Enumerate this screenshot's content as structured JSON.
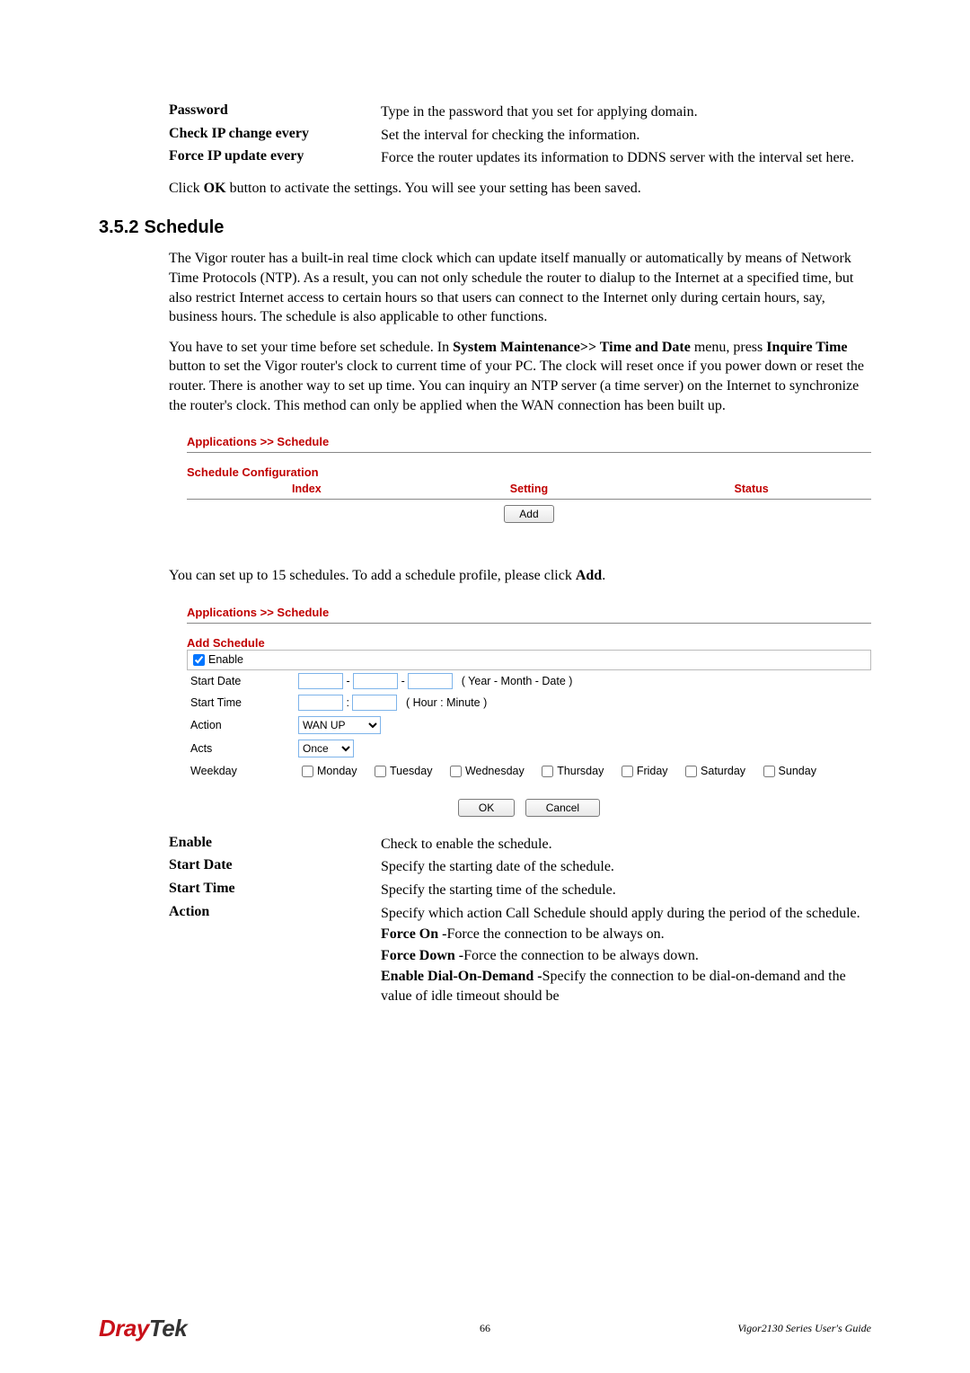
{
  "defs_top": [
    {
      "term": "Password",
      "desc": "Type in the password that you set for applying domain."
    },
    {
      "term": "Check IP change every",
      "desc": "Set the interval for checking the information."
    },
    {
      "term": "Force IP update every",
      "desc": "Force the router updates its information to DDNS server with the interval set here."
    }
  ],
  "click_ok": {
    "pre": "Click ",
    "bold": "OK",
    "post": " button to activate the settings. You will see your setting has been saved."
  },
  "heading": {
    "num": "3.5.2",
    "title": "Schedule"
  },
  "para1": "The Vigor router has a built-in real time clock which can update itself manually or automatically by means of Network Time Protocols (NTP). As a result, you can not only schedule the router to dialup to the Internet at a specified time, but also restrict Internet access to certain hours so that users can connect to the Internet only during certain hours, say, business hours. The schedule is also applicable to other functions.",
  "para2": {
    "seg1": "You have to set your time before set schedule. In ",
    "b1": "System Maintenance>> Time and Date",
    "seg2": " menu, press ",
    "b2": "Inquire Time",
    "seg3": " button to set the Vigor router's clock to current time of your PC. The clock will reset once if you power down or reset the router. There is another way to set up time. You can inquiry an NTP server (a time server) on the Internet to synchronize the router's clock. This method can only be applied when the WAN connection has been built up."
  },
  "ui1": {
    "breadcrumb": "Applications >> Schedule",
    "section": "Schedule Configuration",
    "cols": [
      "Index",
      "Setting",
      "Status"
    ],
    "add_btn": "Add"
  },
  "para3": {
    "pre": "You can set up to 15 schedules. To add a schedule profile, please click ",
    "bold": "Add",
    "post": "."
  },
  "ui2": {
    "breadcrumb": "Applications >> Schedule",
    "section": "Add Schedule",
    "enable": "Enable",
    "rows": {
      "start_date": {
        "label": "Start Date",
        "sep": "-",
        "hint": "( Year - Month - Date )"
      },
      "start_time": {
        "label": "Start Time",
        "sep": ":",
        "hint": "( Hour : Minute )"
      },
      "action": {
        "label": "Action",
        "value": "WAN UP"
      },
      "acts": {
        "label": "Acts",
        "value": "Once"
      },
      "weekday": {
        "label": "Weekday"
      }
    },
    "weekdays": [
      "Monday",
      "Tuesday",
      "Wednesday",
      "Thursday",
      "Friday",
      "Saturday",
      "Sunday"
    ],
    "ok_btn": "OK",
    "cancel_btn": "Cancel"
  },
  "defs_bottom": {
    "enable": {
      "term": "Enable",
      "desc": "Check to enable the schedule."
    },
    "start_date": {
      "term": "Start Date",
      "desc": "Specify the starting date of the schedule."
    },
    "start_time": {
      "term": "Start Time",
      "desc": "Specify the starting time of the schedule."
    },
    "action": {
      "term": "Action",
      "intro": "Specify which action Call Schedule should apply during the period of the schedule.",
      "lines": [
        {
          "bold": "Force On -",
          "text": "Force the connection to be always on."
        },
        {
          "bold": "Force Down -",
          "text": "Force the connection to be always down."
        },
        {
          "bold": "Enable Dial-On-Demand -",
          "text": "Specify the connection to be dial-on-demand and the value of idle timeout should be"
        }
      ]
    }
  },
  "footer": {
    "logo1": "Dray",
    "logo2": "Tek",
    "page": "66",
    "guide": "Vigor2130  Series  User's  Guide"
  }
}
